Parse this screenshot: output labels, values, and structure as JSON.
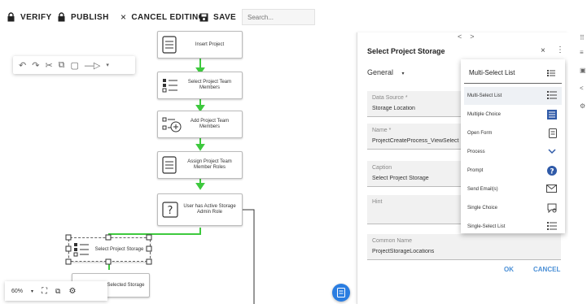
{
  "toolbar": {
    "verify_label": "VERIFY",
    "publish_label": "PUBLISH",
    "cancel_editing_label": "CANCEL EDITING",
    "save_label": "SAVE",
    "search_placeholder": "Search..."
  },
  "canvas": {
    "nodes": {
      "insert_project": "Insert Project",
      "select_team_members": "Select Project Team Members",
      "add_team_members": "Add Project Team Members",
      "assign_roles": "Assign Project Team Member Roles",
      "active_storage_question": "User has Active Storage Admin Role",
      "select_project_storage": "Select Project Storage",
      "selected_storage": "n Selected Storage"
    },
    "zoom_level": "60%",
    "accent_color": "#3ec93e"
  },
  "panel": {
    "title": "Select Project Storage",
    "nav_prev": "<",
    "nav_next": ">",
    "close_glyph": "×",
    "more_glyph": "⋮",
    "section_select": "General",
    "fields": {
      "data_source": {
        "label": "Data Source *",
        "value": "Storage Location"
      },
      "name": {
        "label": "Name *",
        "value": "ProjectCreateProcess_ViewSelect"
      },
      "caption": {
        "label": "Caption",
        "value": "Select Project Storage"
      },
      "hint": {
        "label": "Hint",
        "value": ""
      },
      "common_name": {
        "label": "Common Name",
        "value": "ProjectStorageLocations"
      }
    },
    "ok_label": "OK",
    "cancel_label": "CANCEL"
  },
  "dropdown": {
    "input_value": "Multi-Select List",
    "options": [
      {
        "label": "Multi-Select List",
        "icon": "list-icon"
      },
      {
        "label": "Multiple Choice",
        "icon": "multiple-choice-icon"
      },
      {
        "label": "Open Form",
        "icon": "form-icon"
      },
      {
        "label": "Process",
        "icon": "chevron-down-icon"
      },
      {
        "label": "Prompt",
        "icon": "help-circle-icon"
      },
      {
        "label": "Send Email(s)",
        "icon": "email-icon"
      },
      {
        "label": "Single Choice",
        "icon": "chat-choice-icon"
      },
      {
        "label": "Single-Select List",
        "icon": "list-icon"
      }
    ]
  },
  "rail": {
    "icons": [
      "grid-icon",
      "list-icon",
      "image-icon",
      "code-icon",
      "gear-icon"
    ]
  }
}
